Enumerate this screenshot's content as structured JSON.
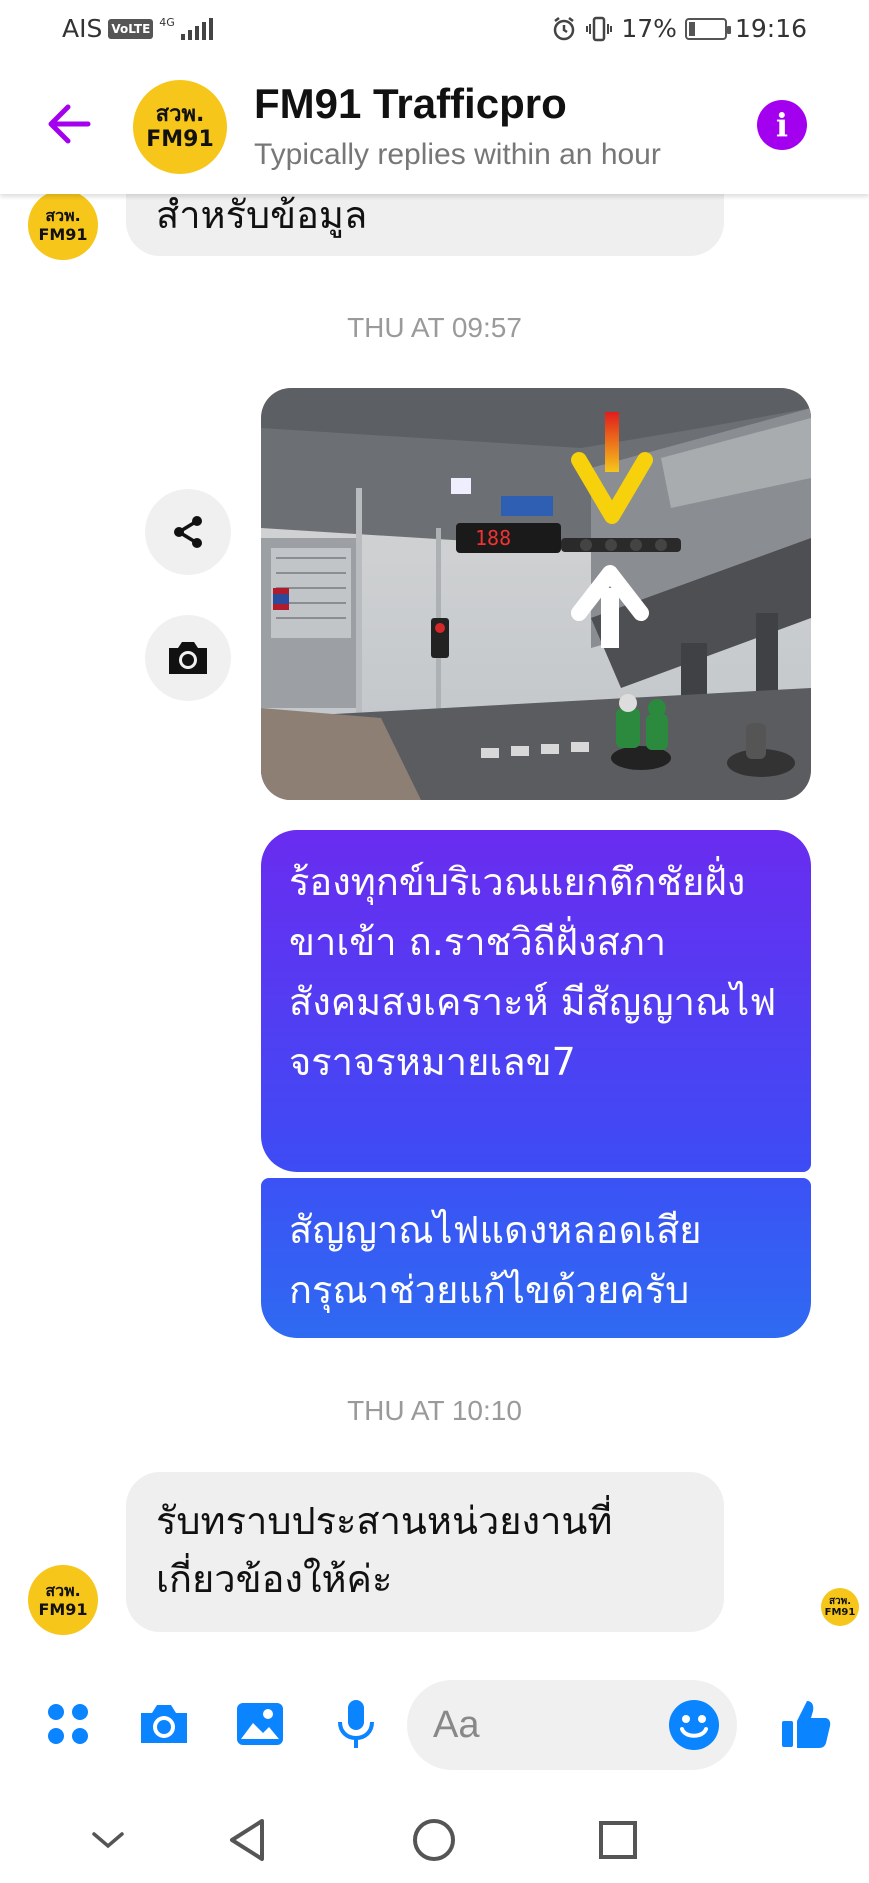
{
  "status_bar": {
    "carrier": "AIS",
    "volte": "VoLTE",
    "network": "4G",
    "battery": "17%",
    "battery_level": 0.17,
    "time": "19:16"
  },
  "header": {
    "avatar_line1": "สวพ.",
    "avatar_line2": "FM91",
    "title": "FM91 Trafficpro",
    "subtitle": "Typically replies within an hour"
  },
  "messages": {
    "first_incoming": "สำหรับข้อมูล",
    "timestamp1": "THU AT 09:57",
    "photo_sign_text": "188",
    "outgoing1": "ร้องทุกข์บริเวณแยกตึกชัยฝั่งขาเข้า ถ.ราชวิถีฝั่งสภาสังคมสงเคราะห์ มีสัญญาณไฟจราจรหมายเลข7",
    "outgoing2": "สัญญาณไฟแดงหลอดเสียกรุณาช่วยแก้ไขด้วยครับ",
    "timestamp2": "THU AT 10:10",
    "reply": "รับทราบประสานหน่วยงานที่เกี่ยวข้องให้ค่ะ"
  },
  "composer": {
    "placeholder": "Aa"
  },
  "colors": {
    "accent_purple": "#a400f0",
    "bubble_top": "#6a2cf0",
    "bubble_bottom": "#2f6af2",
    "icon_blue": "#0a84ff",
    "avatar_yellow": "#f6c61a"
  },
  "icons": [
    "back-arrow-icon",
    "info-icon",
    "share-icon",
    "camera-icon",
    "apps-icon",
    "image-icon",
    "microphone-icon",
    "emoji-icon",
    "thumbs-up-icon",
    "nav-back-icon",
    "nav-home-icon",
    "nav-recents-icon",
    "nav-collapse-icon"
  ]
}
